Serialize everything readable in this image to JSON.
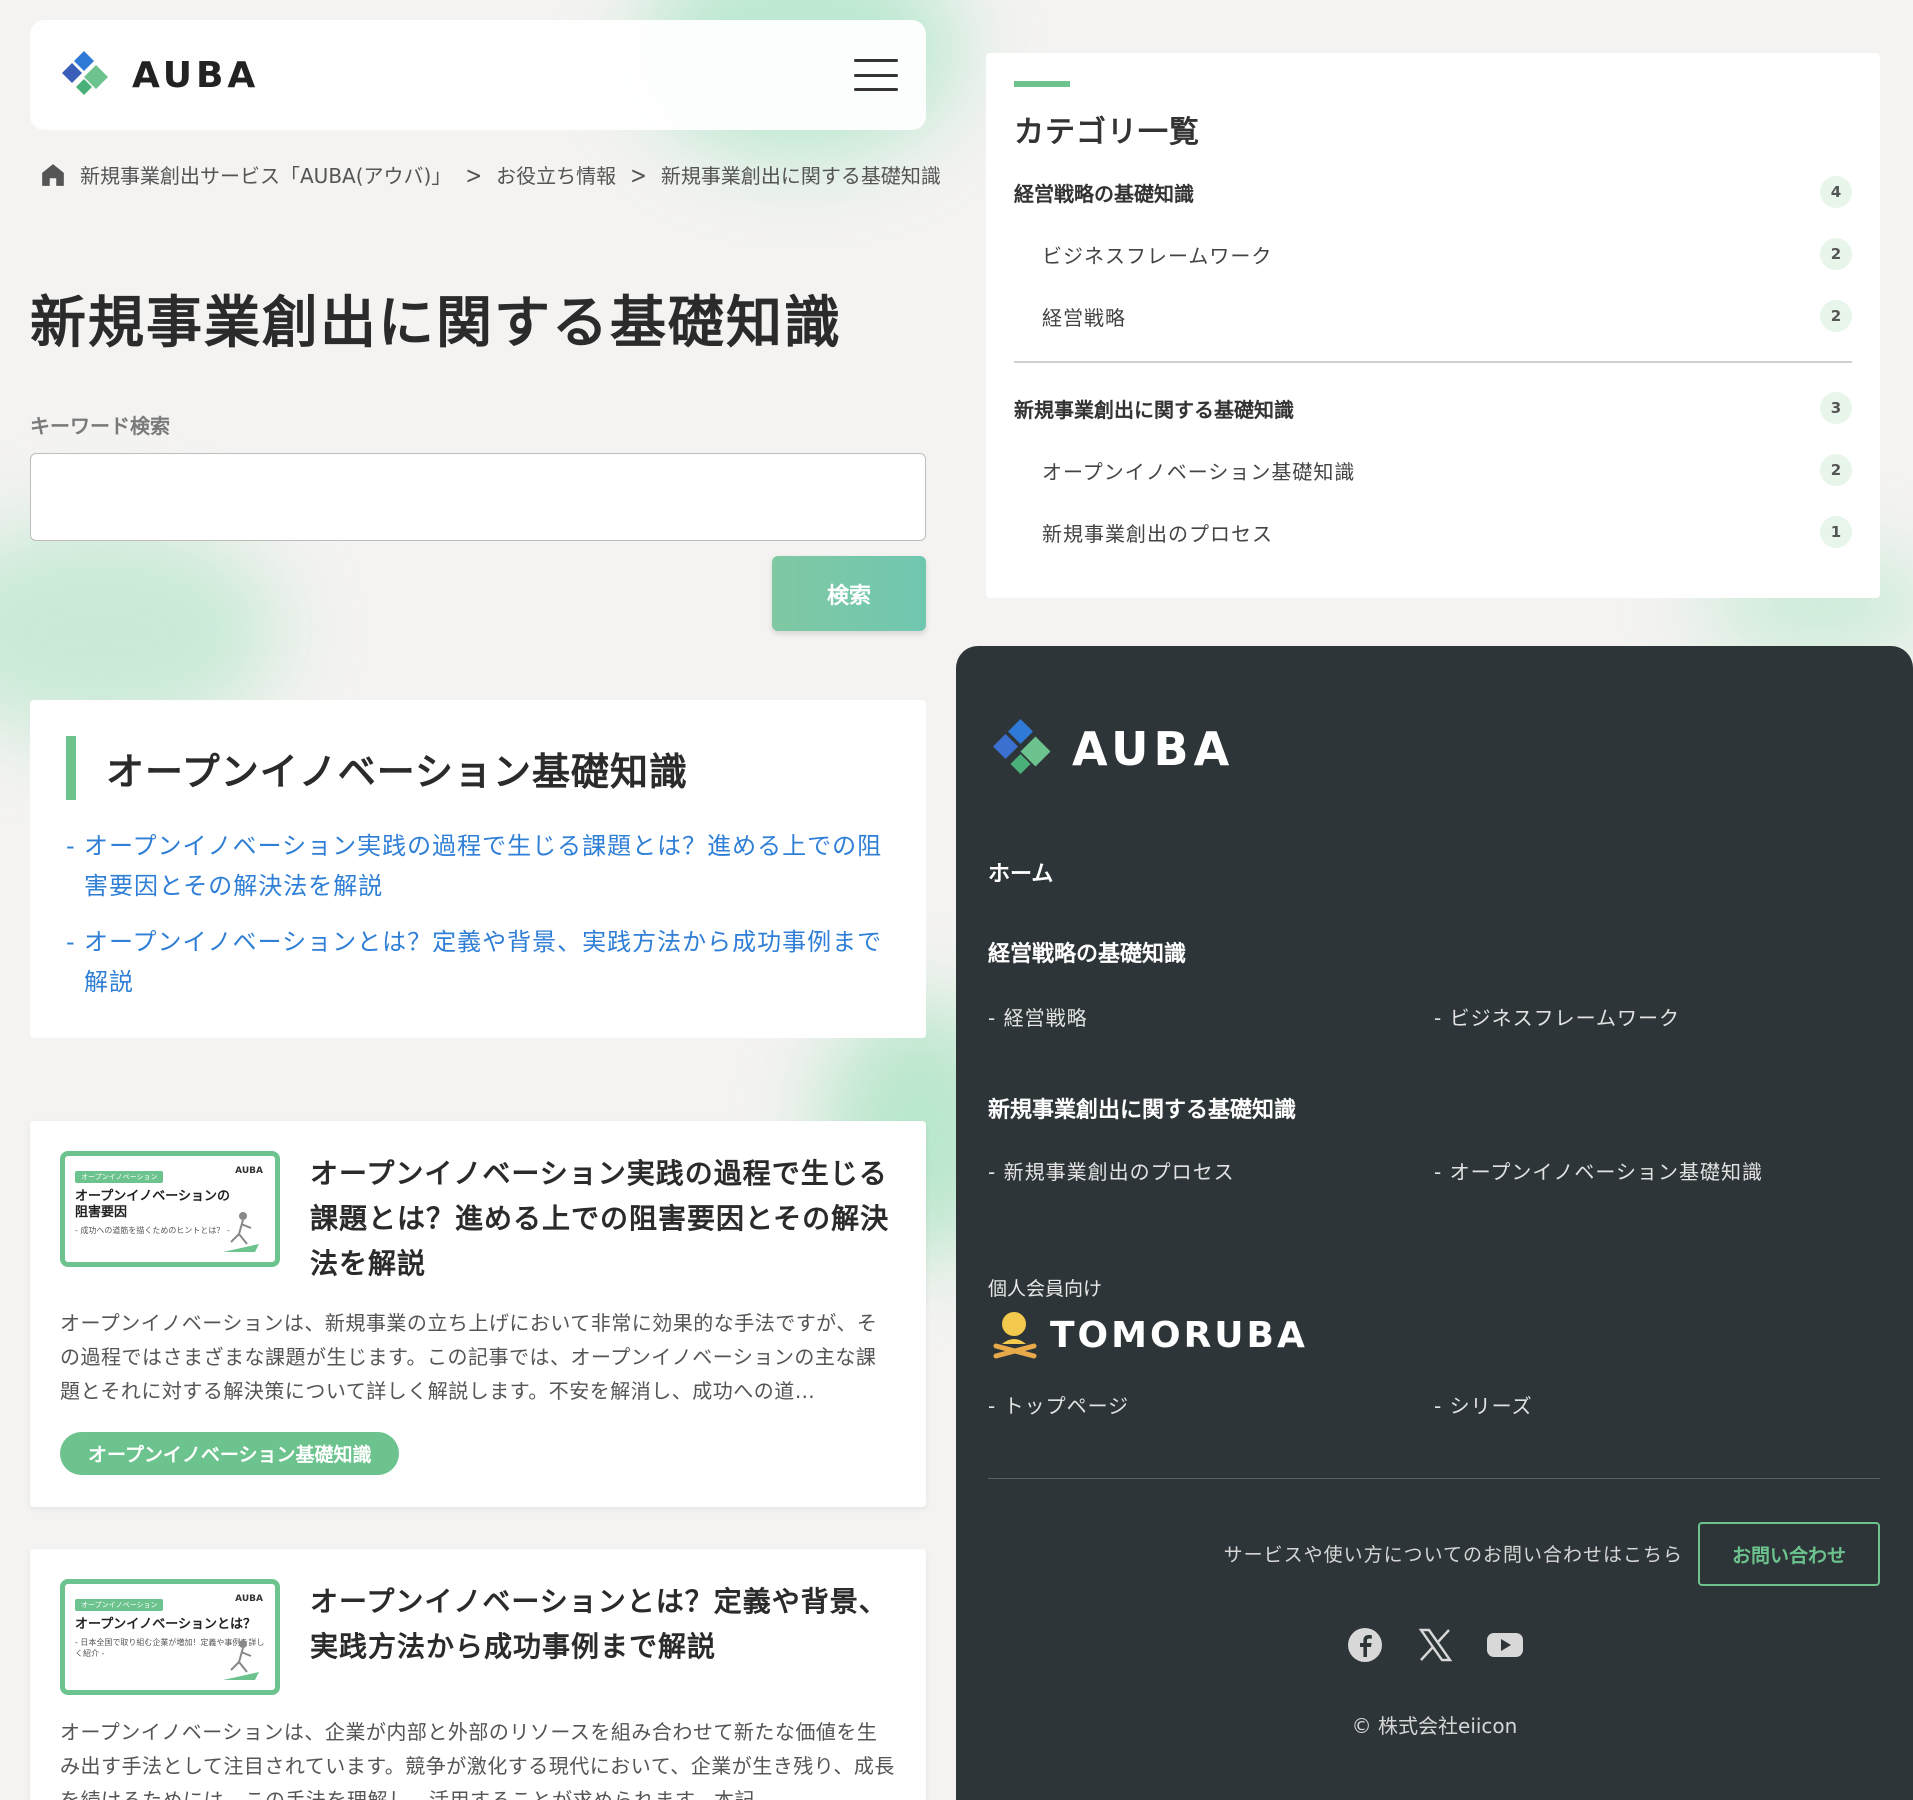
{
  "colors": {
    "accent": "#6cc38e",
    "link": "#2f7fd6",
    "footer_bg": "#2e3538"
  },
  "header": {
    "logo_text": "AUBA",
    "menu_icon": "hamburger-icon"
  },
  "breadcrumb": {
    "home_icon": "home-icon",
    "items": [
      "新規事業創出サービス「AUBA(アウバ)」",
      "お役立ち情報",
      "新規事業創出に関する基礎知識"
    ]
  },
  "page_title": "新規事業創出に関する基礎知識",
  "search": {
    "label": "キーワード検索",
    "value": "",
    "placeholder": "",
    "button": "検索"
  },
  "category_box": {
    "title": "オープンイノベーション基礎知識",
    "links": [
      "オープンイノベーション実践の過程で生じる課題とは？進める上での阻害要因とその解決法を解説",
      "オープンイノベーションとは？定義や背景、実践方法から成功事例まで解説"
    ]
  },
  "articles": [
    {
      "thumb_tag": "オープンイノベーション",
      "thumb_brand": "AUBA",
      "thumb_title_l1": "オープンイノベーションの",
      "thumb_title_l2": "阻害要因",
      "thumb_sub": "- 成功への道筋を描くためのヒントとは？ -",
      "title": "オープンイノベーション実践の過程で生じる課題とは？進める上での阻害要因とその解決法を解説",
      "excerpt": "オープンイノベーションは、新規事業の立ち上げにおいて非常に効果的な手法ですが、その過程ではさまざまな課題が生じます。この記事では、オープンイノベーションの主な課題とそれに対する解決策について詳しく解説します。不安を解消し、成功への道…",
      "tag": "オープンイノベーション基礎知識"
    },
    {
      "thumb_tag": "オープンイノベーション",
      "thumb_brand": "AUBA",
      "thumb_title_l1": "オープンイノベーションとは？",
      "thumb_title_l2": "",
      "thumb_sub": "- 日本全国で取り組む企業が増加！定義や事例を詳しく紹介 -",
      "title": "オープンイノベーションとは？定義や背景、実践方法から成功事例まで解説",
      "excerpt": "オープンイノベーションは、企業が内部と外部のリソースを組み合わせて新たな価値を生み出す手法として注目されています。競争が激化する現代において、企業が生き残り、成長を続けるためには、この手法を理解し、活用することが求められます。本記…"
    }
  ],
  "category_panel": {
    "title": "カテゴリ一覧",
    "groups": [
      {
        "name": "経営戦略の基礎知識",
        "count": "4",
        "children": [
          {
            "name": "ビジネスフレームワーク",
            "count": "2"
          },
          {
            "name": "経営戦略",
            "count": "2"
          }
        ]
      },
      {
        "name": "新規事業創出に関する基礎知識",
        "count": "3",
        "children": [
          {
            "name": "オープンイノベーション基礎知識",
            "count": "2"
          },
          {
            "name": "新規事業創出のプロセス",
            "count": "1"
          }
        ]
      }
    ]
  },
  "footer": {
    "logo_text": "AUBA",
    "home": "ホーム",
    "sections": [
      {
        "title": "経営戦略の基礎知識",
        "items": [
          "- 経営戦略",
          "- ビジネスフレームワーク"
        ]
      },
      {
        "title": "新規事業創出に関する基礎知識",
        "items": [
          "- 新規事業創出のプロセス",
          "- オープンイノベーション基礎知識"
        ]
      }
    ],
    "personal_label": "個人会員向け",
    "tomoruba_text": "TOMORUBA",
    "tomoruba_items": [
      "- トップページ",
      "- シリーズ"
    ],
    "contact_text": "サービスや使い方についてのお問い合わせはこちら",
    "contact_button": "お問い合わせ",
    "social": [
      "facebook-icon",
      "x-icon",
      "youtube-icon"
    ],
    "copyright": "© 株式会社eiicon"
  }
}
